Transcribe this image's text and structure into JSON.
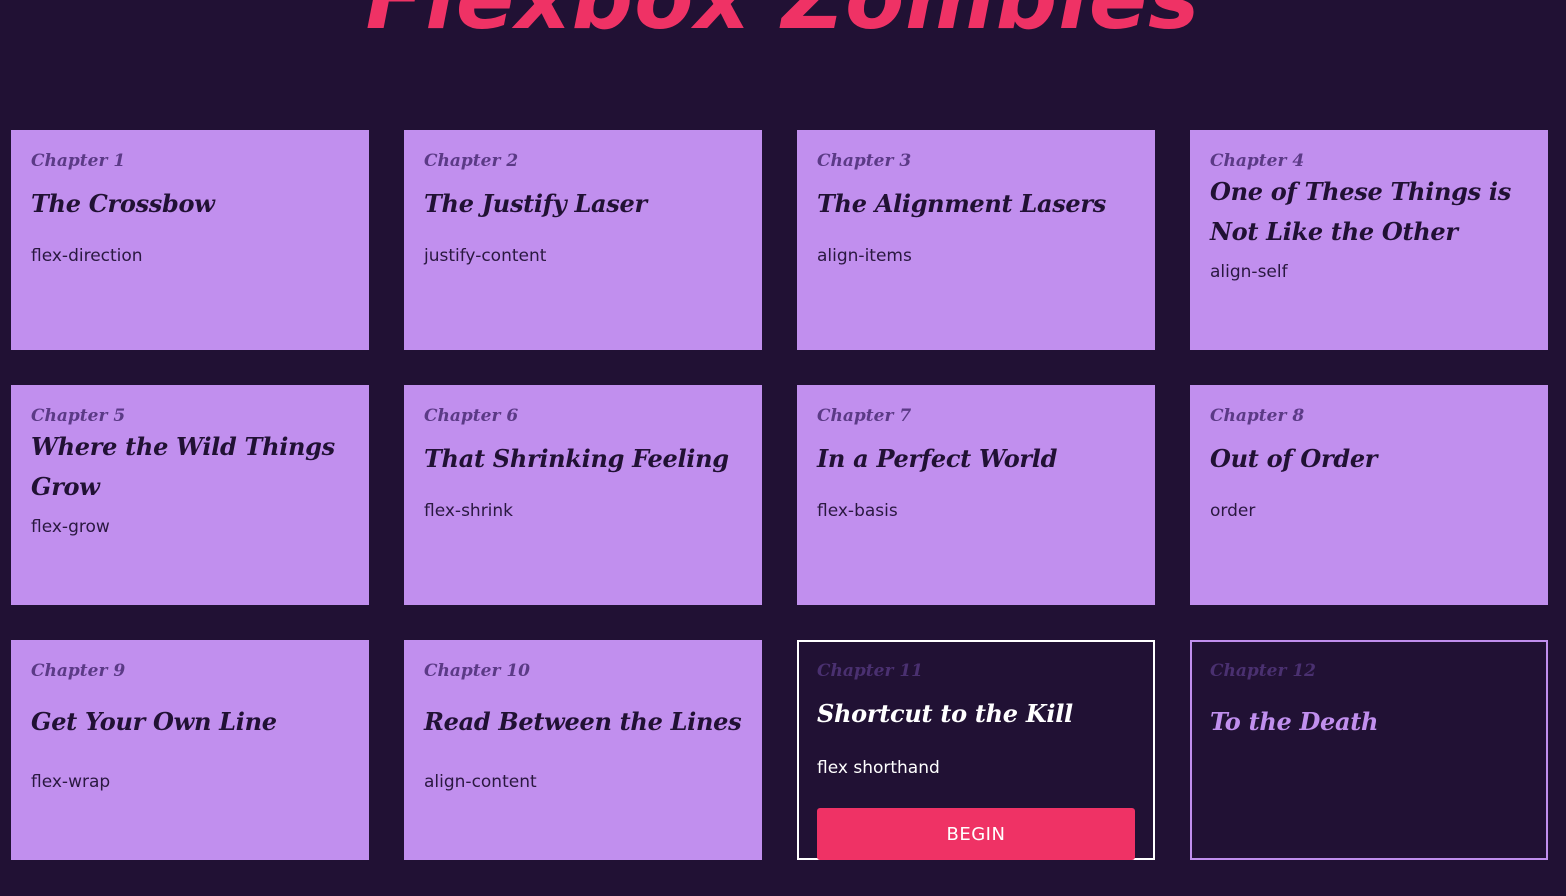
{
  "site_title": "Flexbox Zombies",
  "chapters": [
    {
      "chapter": "Chapter 1",
      "title": "The Crossbow",
      "topic": "flex-direction"
    },
    {
      "chapter": "Chapter 2",
      "title": "The Justify Laser",
      "topic": "justify-content"
    },
    {
      "chapter": "Chapter 3",
      "title": "The Alignment Lasers",
      "topic": "align-items"
    },
    {
      "chapter": "Chapter 4",
      "title": "One of These Things is Not Like the Other",
      "topic": "align-self"
    },
    {
      "chapter": "Chapter 5",
      "title": "Where the Wild Things Grow",
      "topic": "flex-grow"
    },
    {
      "chapter": "Chapter 6",
      "title": "That Shrinking Feeling",
      "topic": "flex-shrink"
    },
    {
      "chapter": "Chapter 7",
      "title": "In a Perfect World",
      "topic": "flex-basis"
    },
    {
      "chapter": "Chapter 8",
      "title": "Out of Order",
      "topic": "order"
    },
    {
      "chapter": "Chapter 9",
      "title": "Get Your Own Line",
      "topic": "flex-wrap"
    },
    {
      "chapter": "Chapter 10",
      "title": "Read Between the Lines",
      "topic": "align-content"
    },
    {
      "chapter": "Chapter 11",
      "title": "Shortcut to the Kill",
      "topic": "flex shorthand",
      "button_label": "BEGIN"
    },
    {
      "chapter": "Chapter 12",
      "title": "To the Death"
    }
  ],
  "colors": {
    "background": "#211134",
    "card": "#c18fee",
    "accent": "#ef3265",
    "active_border": "#ffffff"
  }
}
